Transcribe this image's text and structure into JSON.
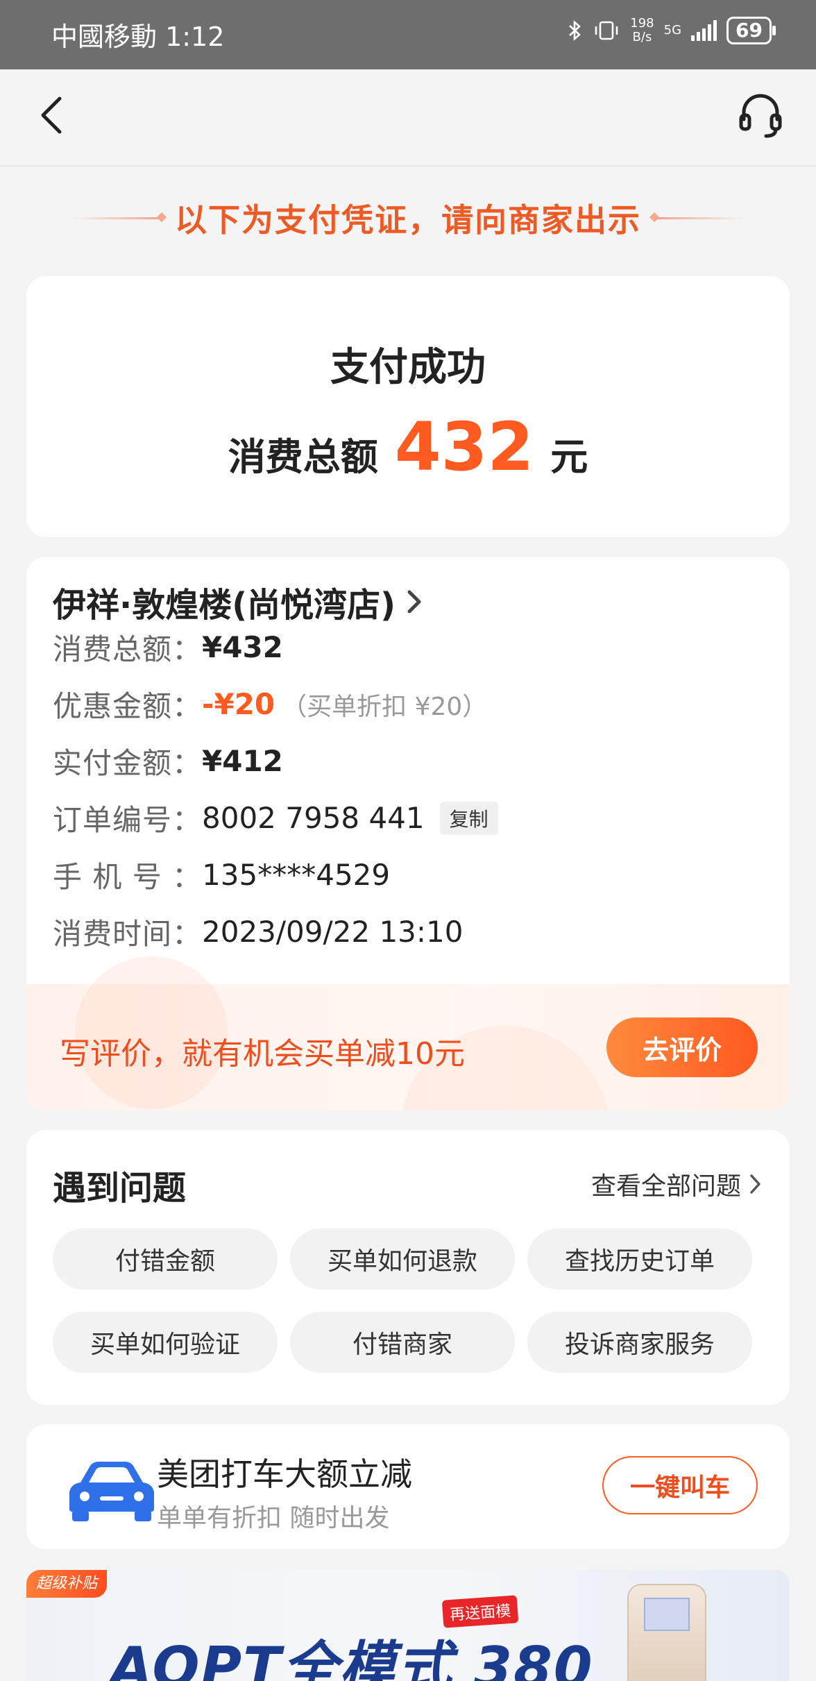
{
  "status_bar": {
    "carrier_time": "中國移動 1:12",
    "net_speed_top": "198",
    "net_speed_bottom": "B/s",
    "network": "5G",
    "battery": "69"
  },
  "nav": {
    "back_icon": "chevron-left-icon",
    "service_icon": "headset-icon"
  },
  "hint": "以下为支付凭证，请向商家出示",
  "payment": {
    "status": "支付成功",
    "total_label": "消费总额",
    "amount": "432",
    "unit": "元"
  },
  "order": {
    "shop_name": "伊祥·敦煌楼(尚悦湾店)",
    "rows": {
      "total": {
        "label": "消费总额：",
        "value": "¥432"
      },
      "discount": {
        "label": "优惠金额：",
        "value": "-¥20",
        "note": "（买单折扣 ¥20）"
      },
      "paid": {
        "label": "实付金额：",
        "value": "¥412"
      },
      "order_no": {
        "label": "订单编号：",
        "value": "8002 7958 441",
        "copy_label": "复制"
      },
      "phone": {
        "label": "手 机 号 ：",
        "value": "135****4529"
      },
      "time": {
        "label": "消费时间：",
        "value": "2023/09/22 13:10"
      }
    },
    "review": {
      "text": "写评价，就有机会买单减10元",
      "button": "去评价"
    }
  },
  "faq": {
    "title": "遇到问题",
    "view_all": "查看全部问题",
    "chips": [
      "付错金额",
      "买单如何退款",
      "查找历史订单",
      "买单如何验证",
      "付错商家",
      "投诉商家服务"
    ]
  },
  "taxi": {
    "icon": "car-icon",
    "title": "美团打车大额立减",
    "subtitle": "单单有折扣 随时出发",
    "button": "一键叫车"
  },
  "ad": {
    "tag": "超级补贴",
    "badge": "再送面模",
    "headline": "AOPT全模式 380"
  },
  "colors": {
    "accent": "#ff5a1f",
    "accent_text": "#ee4e1e",
    "background": "#f4f4f4",
    "car_blue": "#2f6fe8"
  }
}
